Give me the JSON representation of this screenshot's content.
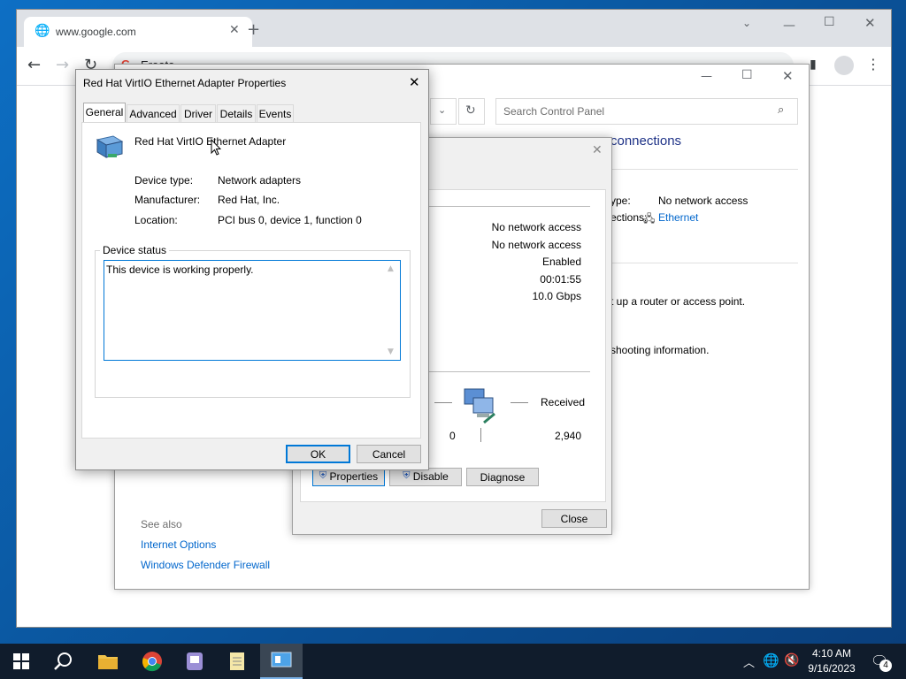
{
  "chrome": {
    "tab_title": "www.google.com",
    "address_partial": "Ereate"
  },
  "control_panel": {
    "search_placeholder": "Search Control Panel",
    "heading_partial": "connections",
    "access_type_label": "ype:",
    "access_type_value": "No network access",
    "connections_label": "ections:",
    "connections_value": "Ethernet",
    "router_text": "t up a router or access point.",
    "troubleshoot_text": "shooting information.",
    "see_also": "See also",
    "see_also_links": [
      "Internet Options",
      "Windows Defender Firewall"
    ]
  },
  "status_dialog": {
    "rows": [
      "No network access",
      "No network access",
      "Enabled",
      "00:01:55",
      "10.0 Gbps"
    ],
    "received_label": "Received",
    "sent_value": "0",
    "received_value": "2,940",
    "buttons": {
      "properties": "Properties",
      "disable": "Disable",
      "diagnose": "Diagnose",
      "close": "Close"
    }
  },
  "properties_dialog": {
    "title": "Red Hat VirtIO Ethernet Adapter Properties",
    "tabs": [
      "General",
      "Advanced",
      "Driver",
      "Details",
      "Events"
    ],
    "device_name": "Red Hat VirtIO Ethernet Adapter",
    "fields": [
      {
        "label": "Device type:",
        "value": "Network adapters"
      },
      {
        "label": "Manufacturer:",
        "value": "Red Hat, Inc."
      },
      {
        "label": "Location:",
        "value": "PCI bus 0, device 1, function 0"
      }
    ],
    "device_status_label": "Device status",
    "device_status_text": "This device is working properly.",
    "ok": "OK",
    "cancel": "Cancel"
  },
  "taskbar": {
    "time": "4:10 AM",
    "date": "9/16/2023",
    "notification_count": "4"
  }
}
